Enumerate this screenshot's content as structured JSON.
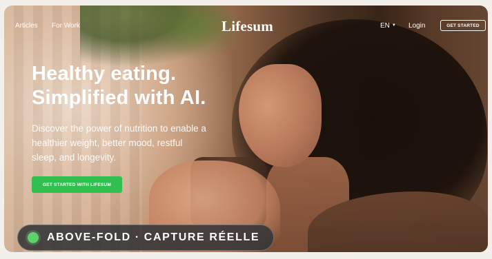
{
  "nav": {
    "links": [
      "Articles",
      "For Work"
    ],
    "logo": "Lifesum",
    "language": "EN",
    "login": "Login",
    "cta": "GET STARTED"
  },
  "hero": {
    "title_lines": [
      "Healthy eating.",
      "Simplified with AI."
    ],
    "subtitle_lines": [
      "Discover the power of nutrition to enable a",
      "healthier weight, better mood, restful",
      "sleep, and longevity."
    ],
    "cta": "GET STARTED WITH LIFESUM"
  },
  "badge": {
    "text": "ABOVE-FOLD · CAPTURE RÉELLE"
  },
  "icons": {
    "language_caret": "caret-down-icon",
    "status_dot": "status-dot-icon"
  },
  "colors": {
    "accent_green": "#2fc04f",
    "badge_dot": "#5fd16b",
    "badge_bg": "#343437"
  }
}
